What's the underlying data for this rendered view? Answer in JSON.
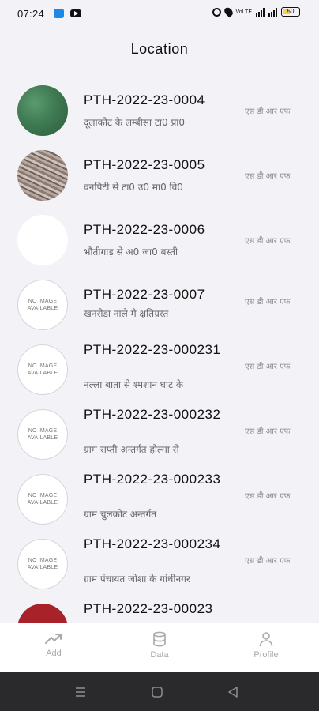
{
  "status_bar": {
    "time": "07:24",
    "network": "VoLTE",
    "battery": "50"
  },
  "header": {
    "title": "Location"
  },
  "items": [
    {
      "code": "PTH-2022-23-0004",
      "desc": "दूलाकोट के लम्बीसा टा0 प्रा0",
      "tag": "एस डी आर एफ",
      "thumb": "photo-green"
    },
    {
      "code": "PTH-2022-23-0005",
      "desc": "वनपिटी से टा0 उ0 मा0 वि0",
      "tag": "एस डी आर एफ",
      "thumb": "photo-stripes"
    },
    {
      "code": "PTH-2022-23-0006",
      "desc": "भौतीगाड़ से अ0 जा0 बस्ती",
      "tag": "एस डी आर एफ",
      "thumb": "photo-blank"
    },
    {
      "code": "PTH-2022-23-0007",
      "desc": " खनरौडा  नाले मे क्षतिग्रस्त",
      "tag": "एस डी आर एफ",
      "thumb": "no-image",
      "thumb_text": "NO IMAGE AVAILABLE"
    },
    {
      "code": "PTH-2022-23-000231",
      "desc": "नल्ला बाता से श्मशान घाट के",
      "tag": "एस डी आर एफ",
      "thumb": "no-image",
      "thumb_text": "NO IMAGE AVAILABLE"
    },
    {
      "code": "PTH-2022-23-000232",
      "desc": "ग्राम राप्ती अन्तर्गत होल्मा से",
      "tag": "एस डी आर एफ",
      "thumb": "no-image",
      "thumb_text": "NO IMAGE AVAILABLE"
    },
    {
      "code": "PTH-2022-23-000233",
      "desc": "ग्राम चुलकोट अन्तर्गत",
      "tag": "एस डी आर एफ",
      "thumb": "no-image",
      "thumb_text": "NO IMAGE AVAILABLE"
    },
    {
      "code": "PTH-2022-23-000234",
      "desc": "ग्राम पंचायत जोशा के गांधीनगर",
      "tag": "एस डी आर एफ",
      "thumb": "no-image",
      "thumb_text": "NO IMAGE AVAILABLE"
    },
    {
      "code": "PTH-2022-23-00023",
      "desc": "",
      "tag": "",
      "thumb": "photo-red"
    }
  ],
  "tabs": {
    "add": {
      "label": "Add",
      "icon": "trending-up-icon"
    },
    "data": {
      "label": "Data",
      "icon": "database-icon"
    },
    "profile": {
      "label": "Profile",
      "icon": "user-icon"
    }
  },
  "colors": {
    "background": "#f2f2f7",
    "tab_inactive": "#aaaaaa",
    "nav_bar": "#2a2a2c"
  }
}
